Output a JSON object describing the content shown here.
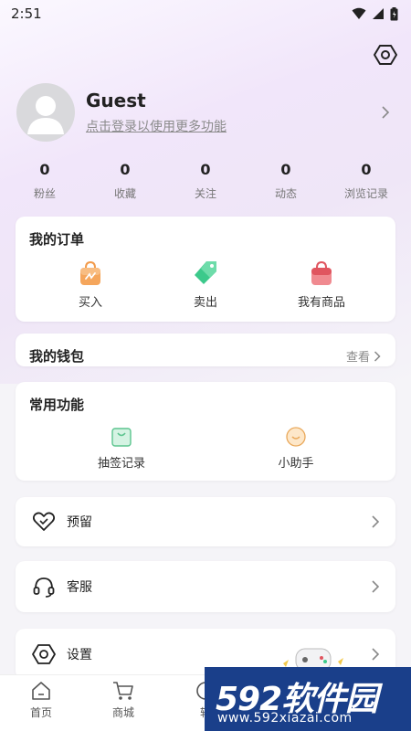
{
  "status_bar": {
    "time": "2:51"
  },
  "profile": {
    "name": "Guest",
    "login_prompt": "点击登录以使用更多功能"
  },
  "stats": [
    {
      "value": "0",
      "label": "粉丝"
    },
    {
      "value": "0",
      "label": "收藏"
    },
    {
      "value": "0",
      "label": "关注"
    },
    {
      "value": "0",
      "label": "动态"
    },
    {
      "value": "0",
      "label": "浏览记录"
    }
  ],
  "orders": {
    "title": "我的订单",
    "items": [
      {
        "label": "买入",
        "icon": "shopping-bag-orange-icon"
      },
      {
        "label": "卖出",
        "icon": "price-tag-green-icon"
      },
      {
        "label": "我有商品",
        "icon": "shopping-bag-red-icon"
      }
    ]
  },
  "wallet": {
    "title": "我的钱包",
    "more_label": "查看"
  },
  "common_features": {
    "title": "常用功能",
    "items": [
      {
        "label": "抽签记录",
        "icon": "lottery-bag-icon"
      },
      {
        "label": "小助手",
        "icon": "assistant-face-icon"
      }
    ]
  },
  "menu_rows": [
    {
      "label": "预留",
      "icon": "heart-icon"
    },
    {
      "label": "客服",
      "icon": "headset-icon"
    },
    {
      "label": "设置",
      "icon": "settings-hexagon-icon"
    }
  ],
  "tabbar": {
    "tabs": [
      {
        "label": "首页",
        "icon": "home-icon"
      },
      {
        "label": "商城",
        "icon": "cart-icon"
      },
      {
        "label": "转",
        "icon": "transfer-icon"
      }
    ]
  },
  "watermark": {
    "logo_number": "592",
    "logo_text": "软件园",
    "url": "www.592xiazai.com"
  },
  "colors": {
    "accent_orange": "#f29a4a",
    "accent_green": "#3cc98b",
    "accent_red": "#e0555f",
    "watermark_blue": "#1a3f8a"
  }
}
